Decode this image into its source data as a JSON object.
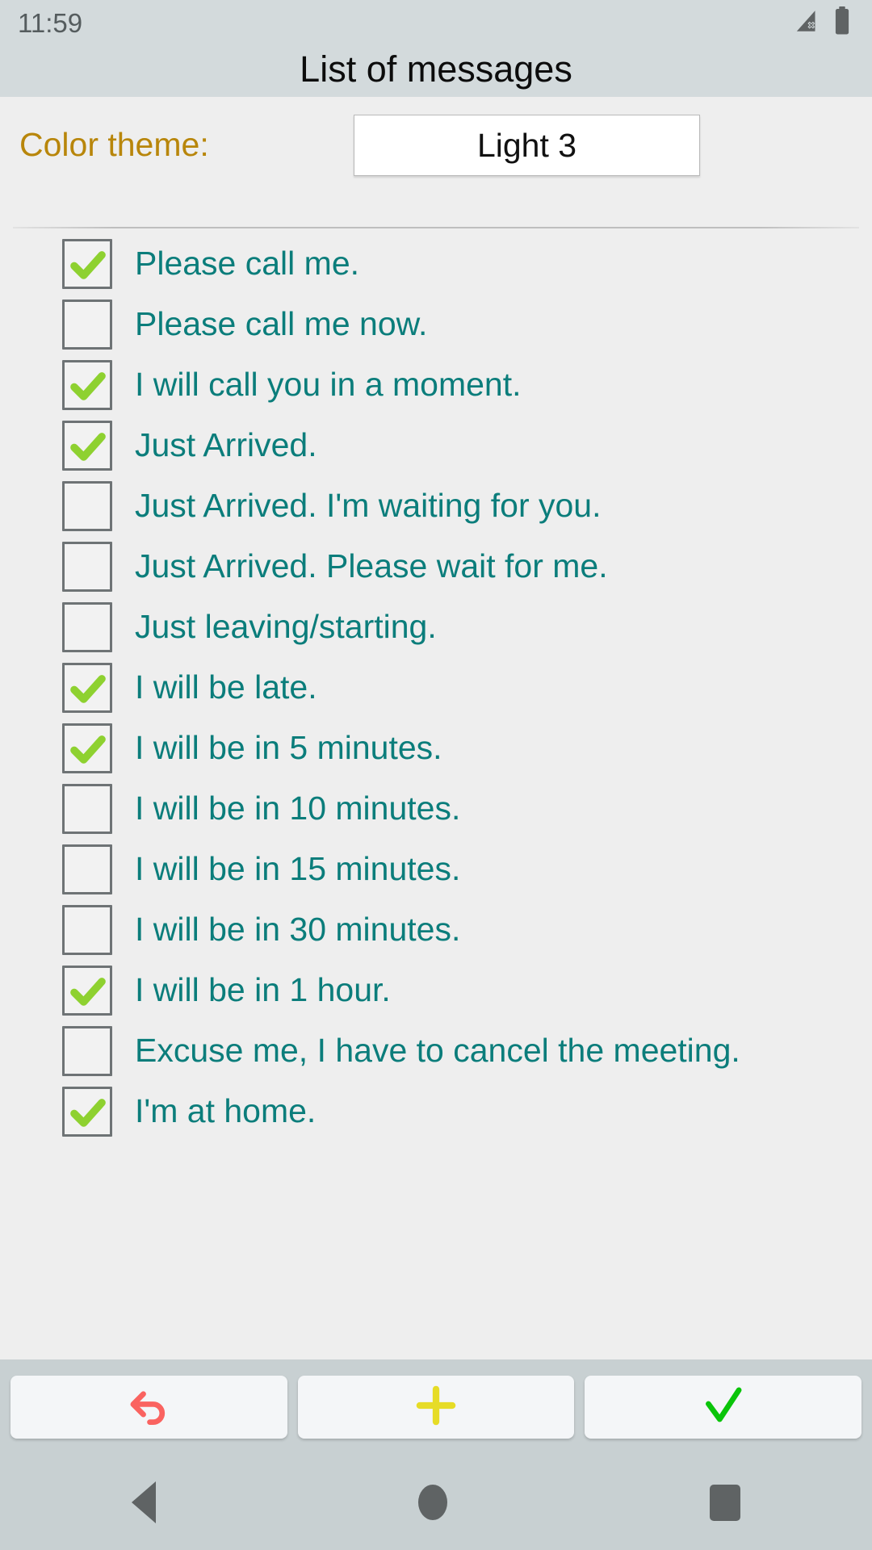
{
  "status_bar": {
    "time": "11:59",
    "signal_icon": "signal-no-service-icon",
    "battery_icon": "battery-full-icon"
  },
  "header": {
    "title": "List of messages"
  },
  "theme": {
    "label": "Color theme:",
    "selected": "Light 3"
  },
  "messages": [
    {
      "text": "Please call me.",
      "checked": true
    },
    {
      "text": "Please call me now.",
      "checked": false
    },
    {
      "text": "I will call you in a moment.",
      "checked": true
    },
    {
      "text": "Just Arrived.",
      "checked": true
    },
    {
      "text": "Just Arrived. I'm waiting for you.",
      "checked": false
    },
    {
      "text": "Just Arrived. Please wait for me.",
      "checked": false
    },
    {
      "text": "Just leaving/starting.",
      "checked": false
    },
    {
      "text": "I will be late.",
      "checked": true
    },
    {
      "text": "I will be in 5 minutes.",
      "checked": true
    },
    {
      "text": "I will be in 10 minutes.",
      "checked": false
    },
    {
      "text": "I will be in 15 minutes.",
      "checked": false
    },
    {
      "text": "I will be in 30 minutes.",
      "checked": false
    },
    {
      "text": "I will be in 1 hour.",
      "checked": true
    },
    {
      "text": "Excuse me, I have to cancel the meeting.",
      "checked": false
    },
    {
      "text": "I'm at home.",
      "checked": true
    }
  ],
  "action_bar": {
    "buttons": [
      {
        "name": "undo-button",
        "icon": "undo-arrow-icon",
        "color": "#fa6360"
      },
      {
        "name": "add-button",
        "icon": "plus-icon",
        "color": "#e6dc27"
      },
      {
        "name": "confirm-button",
        "icon": "check-icon",
        "color": "#0ac40a"
      }
    ]
  },
  "nav_bar": {
    "back": "back-triangle-icon",
    "home": "home-circle-icon",
    "recents": "recents-square-icon"
  },
  "colors": {
    "topbar": "#d3dadc",
    "content": "#eeeeee",
    "accent_text": "#0b7d7b",
    "theme_label": "#b8860b",
    "checkmark": "#8ed130",
    "navbar": "#c8d0d2"
  }
}
